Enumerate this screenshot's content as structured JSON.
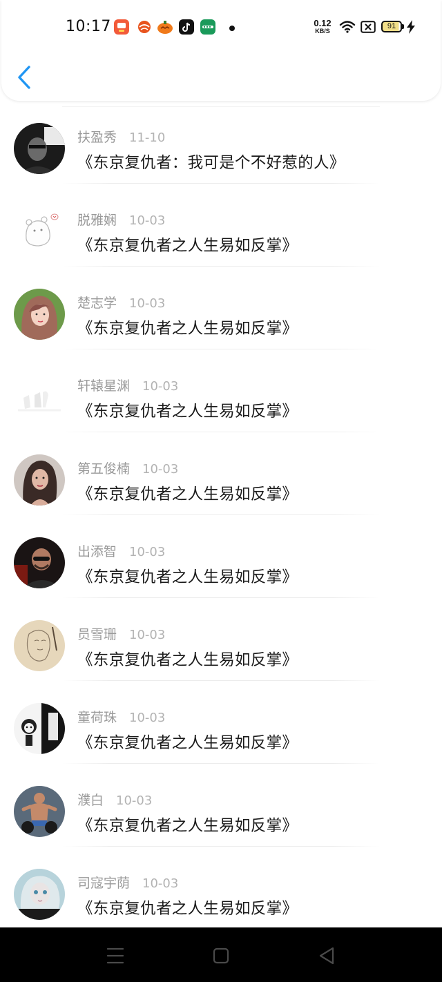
{
  "status_bar": {
    "time": "10:17",
    "app_icons": [
      "app-icon-1",
      "app-icon-2",
      "app-icon-3",
      "tiktok-icon",
      "app-icon-5"
    ],
    "net_speed_value": "0.12",
    "net_speed_unit": "KB/S",
    "battery_level": "91"
  },
  "header": {
    "back_icon": "chevron-left-icon",
    "accent_color": "#2196f3"
  },
  "list": {
    "items": [
      {
        "name": "扶盈秀",
        "date": "11-10",
        "title": "《东京复仇者：我可是个不好惹的人》",
        "avatar": "avatar-man-dark"
      },
      {
        "name": "脱雅娴",
        "date": "10-03",
        "title": "《东京复仇者之人生易如反掌》",
        "avatar": "avatar-bear-sketch"
      },
      {
        "name": "楚志学",
        "date": "10-03",
        "title": "《东京复仇者之人生易如反掌》",
        "avatar": "avatar-woman-pink"
      },
      {
        "name": "轩辕星渊",
        "date": "10-03",
        "title": "《东京复仇者之人生易如反掌》",
        "avatar": "avatar-faint-sketch"
      },
      {
        "name": "第五俊楠",
        "date": "10-03",
        "title": "《东京复仇者之人生易如反掌》",
        "avatar": "avatar-woman-dark"
      },
      {
        "name": "出添智",
        "date": "10-03",
        "title": "《东京复仇者之人生易如反掌》",
        "avatar": "avatar-man-glasses"
      },
      {
        "name": "员雪珊",
        "date": "10-03",
        "title": "《东京复仇者之人生易如反掌》",
        "avatar": "avatar-drawing"
      },
      {
        "name": "童荷珠",
        "date": "10-03",
        "title": "《东京复仇者之人生易如反掌》",
        "avatar": "avatar-cartoon"
      },
      {
        "name": "濮白",
        "date": "10-03",
        "title": "《东京复仇者之人生易如反掌》",
        "avatar": "avatar-fitness"
      },
      {
        "name": "司寇宇荫",
        "date": "10-03",
        "title": "《东京复仇者之人生易如反掌》",
        "avatar": "avatar-anime-girl"
      }
    ]
  },
  "nav_bar": {
    "buttons": [
      "menu-icon",
      "home-icon",
      "back-triangle-icon"
    ]
  }
}
